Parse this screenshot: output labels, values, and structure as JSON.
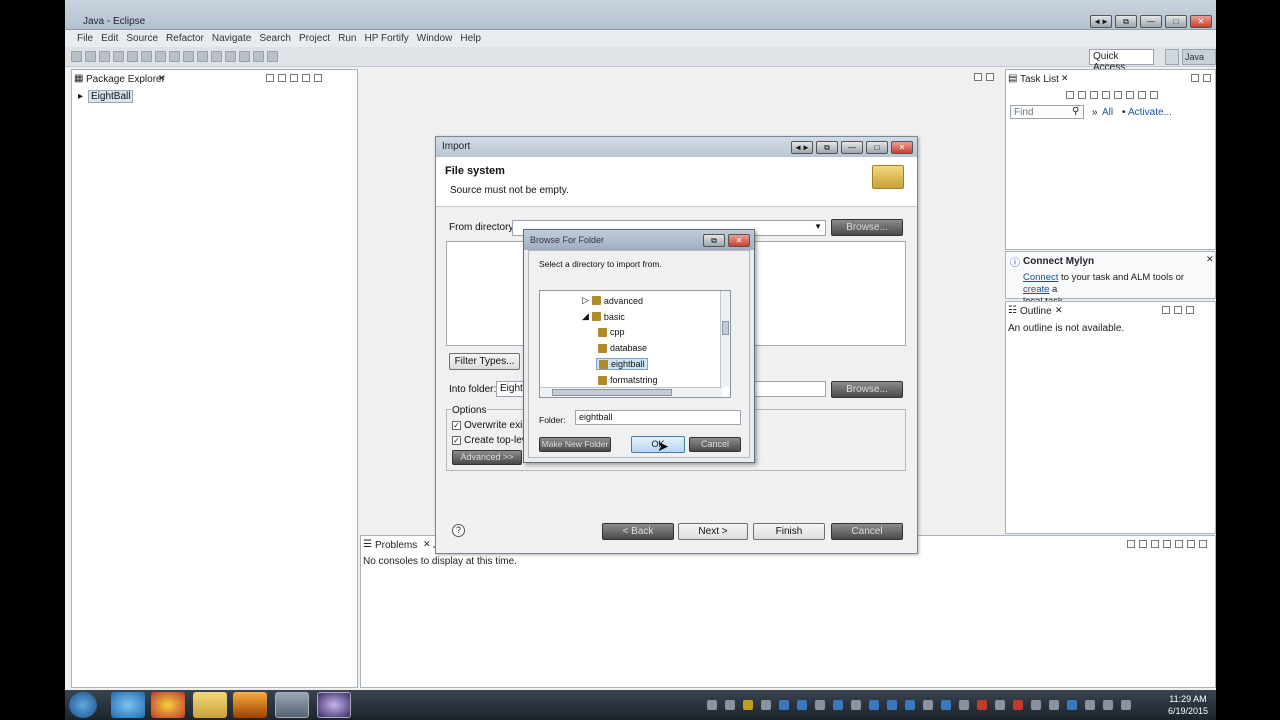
{
  "window": {
    "title": "Java - Eclipse",
    "controls": [
      "◄►",
      "⧉",
      "—",
      "□",
      "✕"
    ]
  },
  "menu": [
    "File",
    "Edit",
    "Source",
    "Refactor",
    "Navigate",
    "Search",
    "Project",
    "Run",
    "HP Fortify",
    "Window",
    "Help"
  ],
  "toolbar": {
    "quick_access": "Quick Access",
    "perspective": "Java"
  },
  "package_explorer": {
    "tab": "Package Explorer",
    "project": "EightBall"
  },
  "task_list": {
    "tab": "Task List",
    "find_placeholder": "Find",
    "all": "All",
    "activate": "Activate..."
  },
  "mylyn": {
    "title": "Connect Mylyn",
    "connect": "Connect",
    "text1": " to your task and ALM tools or ",
    "create": "create",
    "text2": " a",
    "text3": "local task."
  },
  "outline": {
    "tab": "Outline",
    "message": "An outline is not available."
  },
  "console": {
    "tab": "Problems",
    "tab2": "J",
    "message": "No consoles to display at this time."
  },
  "wizard": {
    "title": "Import",
    "heading": "File system",
    "message": "Source must not be empty.",
    "from_dir_label": "From directory:",
    "browse1": "Browse...",
    "filter_types": "Filter Types...",
    "into_folder_label": "Into folder:",
    "into_folder_value": "EightB",
    "browse2": "Browse...",
    "options_label": "Options",
    "overwrite": "Overwrite exist",
    "create_top": "Create top-leve",
    "advanced": "Advanced >>",
    "back": "< Back",
    "next": "Next >",
    "finish": "Finish",
    "cancel": "Cancel",
    "help": "?"
  },
  "folder_dialog": {
    "title": "Browse For Folder",
    "prompt": "Select a directory to import from.",
    "tree": [
      {
        "label": "advanced",
        "expander": "▷",
        "indent": 0
      },
      {
        "label": "basic",
        "expander": "◢",
        "indent": 0
      },
      {
        "label": "cpp",
        "expander": "",
        "indent": 1
      },
      {
        "label": "database",
        "expander": "",
        "indent": 1
      },
      {
        "label": "eightball",
        "expander": "",
        "indent": 1,
        "selected": true
      },
      {
        "label": "formatstring",
        "expander": "",
        "indent": 1
      }
    ],
    "folder_label": "Folder:",
    "folder_value": "eightball",
    "make_new_folder": "Make New Folder",
    "ok": "OK",
    "cancel": "Cancel"
  },
  "taskbar": {
    "time": "11:29 AM",
    "date": "6/19/2015"
  },
  "colors": {
    "accent": "#3a6fb8",
    "selection": "#cfe3f7",
    "taskbar": "#1c232b"
  }
}
